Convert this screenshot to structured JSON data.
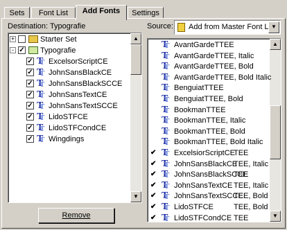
{
  "tabs": [
    {
      "label": "Sets",
      "active": false
    },
    {
      "label": "Font List",
      "active": false
    },
    {
      "label": "Add Fonts",
      "active": true
    },
    {
      "label": "Settings",
      "active": false
    }
  ],
  "destination": {
    "label": "Destination: Typografie",
    "tree": [
      {
        "label": "Starter Set",
        "level": 0,
        "type": "folder",
        "checked": false,
        "expander": "+"
      },
      {
        "label": "Typografie",
        "level": 0,
        "type": "fav-folder",
        "checked": true,
        "expander": "-"
      },
      {
        "label": "ExcelsorScriptCE",
        "level": 1,
        "type": "font",
        "checked": true
      },
      {
        "label": "JohnSansBlackCE",
        "level": 1,
        "type": "font",
        "checked": true
      },
      {
        "label": "JohnSansBlackSCCE",
        "level": 1,
        "type": "font",
        "checked": true
      },
      {
        "label": "JohnSansTextCE",
        "level": 1,
        "type": "font",
        "checked": true
      },
      {
        "label": "JohnSansTextSCCE",
        "level": 1,
        "type": "font",
        "checked": true
      },
      {
        "label": "LidoSTFCE",
        "level": 1,
        "type": "font",
        "checked": true
      },
      {
        "label": "LidoSTFCondCE",
        "level": 1,
        "type": "font",
        "checked": true
      },
      {
        "label": "Wingdings",
        "level": 1,
        "type": "font",
        "checked": true
      }
    ],
    "remove_label": "Remove"
  },
  "source": {
    "label": "Source:",
    "selected": "Add from Master Font List",
    "fonts": [
      {
        "label": "AvantGardeTTEE",
        "checked": false
      },
      {
        "label": "AvantGardeTTEE, Italic",
        "checked": false
      },
      {
        "label": "AvantGardeTTEE, Bold",
        "checked": false
      },
      {
        "label": "AvantGardeTTEE, Bold Italic",
        "checked": false
      },
      {
        "label": "BenguiatTTEE",
        "checked": false
      },
      {
        "label": "BenguiatTTEE, Bold",
        "checked": false
      },
      {
        "label": "BookmanTTEE",
        "checked": false
      },
      {
        "label": "BookmanTTEE, Italic",
        "checked": false
      },
      {
        "label": "BookmanTTEE, Bold",
        "checked": false
      },
      {
        "label": "BookmanTTEE, Bold Italic",
        "checked": false
      },
      {
        "label": "ExcelsiorScriptCE",
        "checked": true,
        "ghost": "TEE"
      },
      {
        "label": "JohnSansBlackCE",
        "checked": true,
        "ghost": "TEE, Italic"
      },
      {
        "label": "JohnSansBlackSCCE",
        "checked": true,
        "ghost": "TEE"
      },
      {
        "label": "JohnSansTextCE",
        "checked": true,
        "ghost": "TEE, Italic"
      },
      {
        "label": "JohnSansTextSCCE",
        "checked": true,
        "ghost": "TEE, Bold"
      },
      {
        "label": "LidoSTFCE",
        "checked": true,
        "ghost": "TEE, Bold"
      },
      {
        "label": "LidoSTFCondCE",
        "checked": true,
        "ghost": "TEE"
      }
    ]
  },
  "colors": {
    "face": "#d4d0c8",
    "icon": "#1a2aa0",
    "selection": "#ffffff"
  }
}
